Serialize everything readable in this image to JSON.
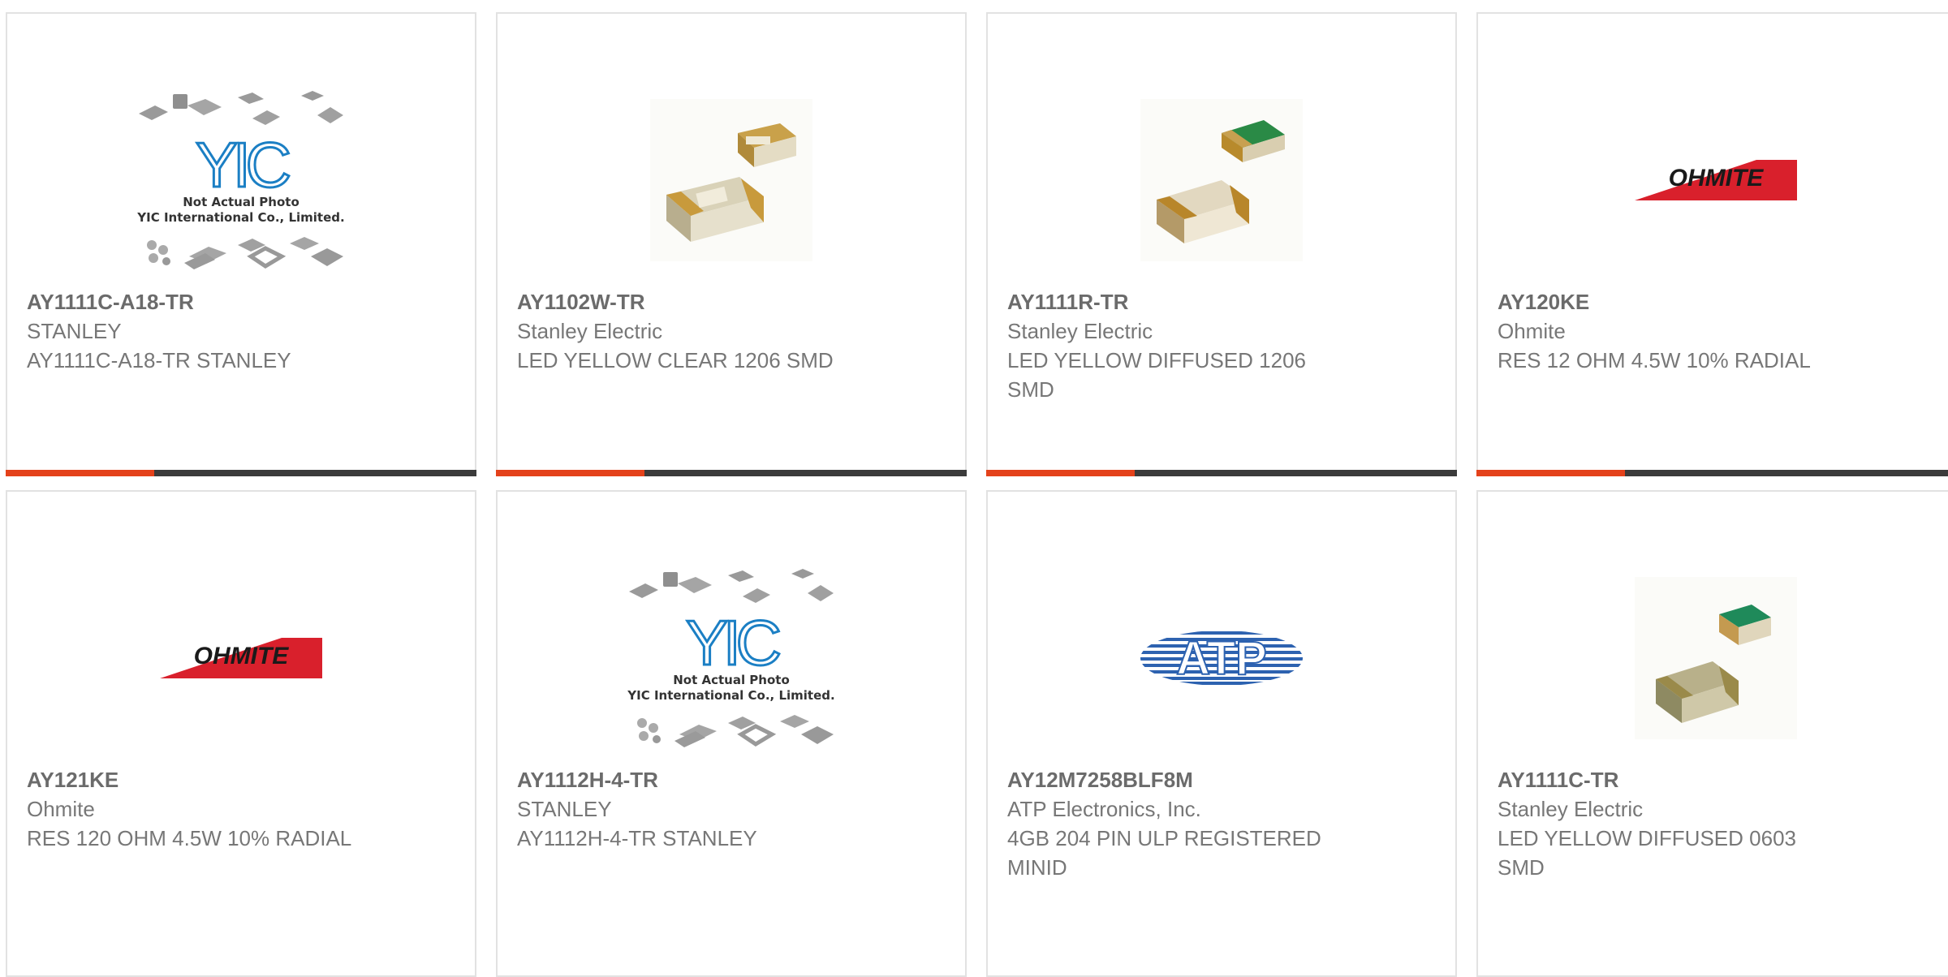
{
  "products": [
    {
      "pn": "AY1111C-A18-TR",
      "mfr": "STANLEY",
      "desc": "AY1111C-A18-TR STANLEY",
      "image": "yic-placeholder",
      "placeholder_caption": "Not Actual Photo",
      "placeholder_company": "YIC International Co., Limited."
    },
    {
      "pn": "AY1102W-TR",
      "mfr": "Stanley Electric",
      "desc": "LED YELLOW CLEAR 1206 SMD",
      "image": "smd-led-yellow"
    },
    {
      "pn": "AY1111R-TR",
      "mfr": "Stanley Electric",
      "desc": "LED YELLOW DIFFUSED 1206 SMD",
      "image": "smd-led-diffused"
    },
    {
      "pn": "AY120KE",
      "mfr": "Ohmite",
      "desc": "RES 12 OHM 4.5W 10% RADIAL",
      "image": "ohmite-logo",
      "logo_text": "OHMITE"
    },
    {
      "pn": "AY121KE",
      "mfr": "Ohmite",
      "desc": "RES 120 OHM 4.5W 10% RADIAL",
      "image": "ohmite-logo",
      "logo_text": "OHMITE"
    },
    {
      "pn": "AY1112H-4-TR",
      "mfr": "STANLEY",
      "desc": "AY1112H-4-TR STANLEY",
      "image": "yic-placeholder",
      "placeholder_caption": "Not Actual Photo",
      "placeholder_company": "YIC International Co., Limited."
    },
    {
      "pn": "AY12M7258BLF8M",
      "mfr": "ATP Electronics, Inc.",
      "desc": "4GB 204 PIN ULP REGISTERED MINID",
      "image": "atp-logo",
      "logo_text": "ATP"
    },
    {
      "pn": "AY1111C-TR",
      "mfr": "Stanley Electric",
      "desc": "LED YELLOW DIFFUSED 0603 SMD",
      "image": "smd-led-0603"
    }
  ],
  "colors": {
    "accent": "#e4421b",
    "bar": "#3b3b3b",
    "ohmite_red": "#d9202c",
    "atp_blue": "#2d62b0"
  }
}
